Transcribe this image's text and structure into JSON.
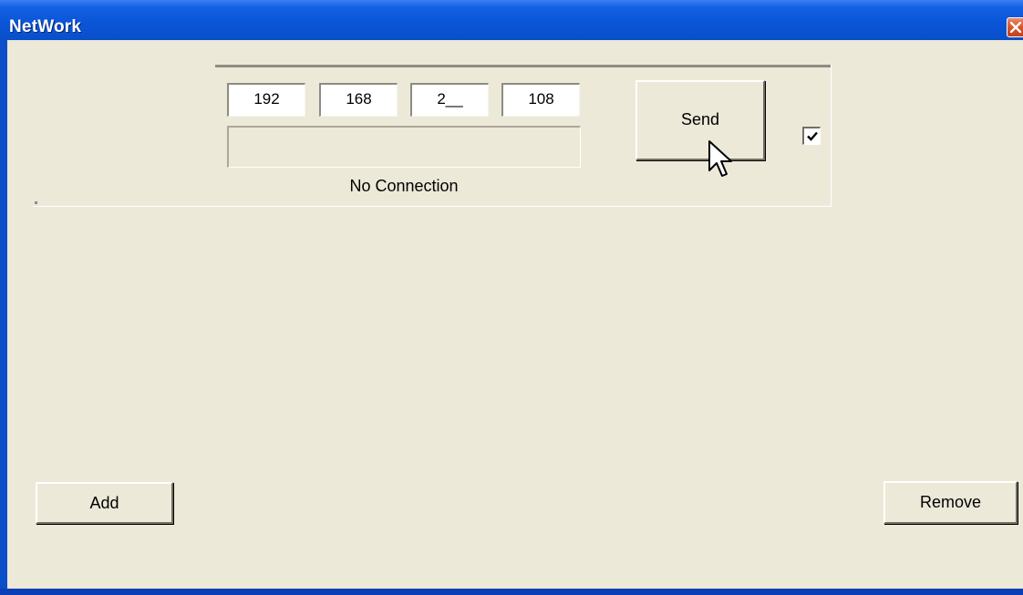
{
  "window": {
    "title": "NetWork",
    "close_icon": "close-icon"
  },
  "ip_address": {
    "octet1": "192",
    "octet2": "168",
    "octet3": "2__",
    "octet4": "108"
  },
  "message": {
    "value": ""
  },
  "status": {
    "text": "No Connection"
  },
  "buttons": {
    "send_label": "Send",
    "add_label": "Add",
    "remove_label": "Remove"
  },
  "checkbox": {
    "checked": true,
    "icon": "checkmark-icon"
  },
  "cursor": {
    "icon": "mouse-pointer-icon"
  },
  "colors": {
    "titlebar": "#0a55d8",
    "client_bg": "#ece9d8",
    "close_button": "#d9542e"
  }
}
